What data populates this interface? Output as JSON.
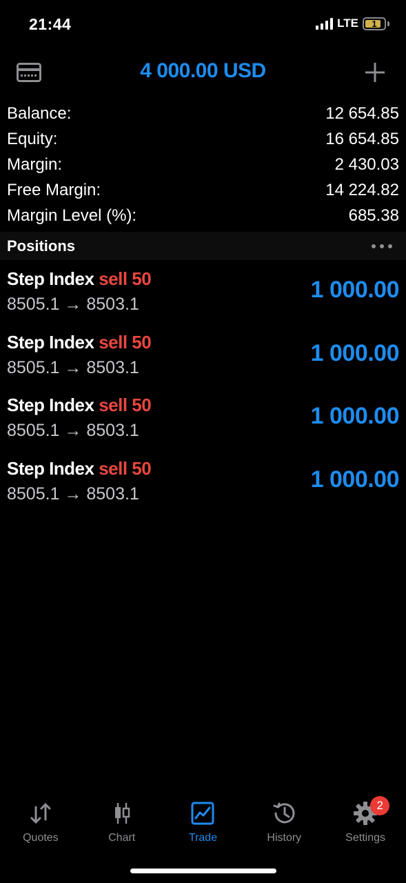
{
  "status_bar": {
    "time": "21:44",
    "network": "LTE",
    "battery": "1"
  },
  "header": {
    "title": "4 000.00 USD",
    "left_icon": "card-icon",
    "right_icon": "plus-icon"
  },
  "summary": [
    {
      "label": "Balance:",
      "value": "12 654.85"
    },
    {
      "label": "Equity:",
      "value": "16 654.85"
    },
    {
      "label": "Margin:",
      "value": "2 430.03"
    },
    {
      "label": "Free Margin:",
      "value": "14 224.82"
    },
    {
      "label": "Margin Level (%):",
      "value": "685.38"
    }
  ],
  "positions": {
    "title": "Positions",
    "items": [
      {
        "symbol": "Step Index",
        "side": "sell 50",
        "prices": "8505.1 → 8503.1",
        "profit": "1 000.00"
      },
      {
        "symbol": "Step Index",
        "side": "sell 50",
        "prices": "8505.1 → 8503.1",
        "profit": "1 000.00"
      },
      {
        "symbol": "Step Index",
        "side": "sell 50",
        "prices": "8505.1 → 8503.1",
        "profit": "1 000.00"
      },
      {
        "symbol": "Step Index",
        "side": "sell 50",
        "prices": "8505.1 → 8503.1",
        "profit": "1 000.00"
      }
    ]
  },
  "tabbar": {
    "tabs": [
      {
        "label": "Quotes",
        "icon": "quotes-arrows-icon"
      },
      {
        "label": "Chart",
        "icon": "candlestick-icon"
      },
      {
        "label": "Trade",
        "icon": "trade-chart-icon",
        "active": true
      },
      {
        "label": "History",
        "icon": "history-clock-icon"
      },
      {
        "label": "Settings",
        "icon": "gear-icon",
        "badge": "2"
      }
    ]
  },
  "colors": {
    "accent": "#1e8cf0",
    "sell": "#e9473f",
    "badge": "#eb3b36",
    "background": "#000000"
  }
}
